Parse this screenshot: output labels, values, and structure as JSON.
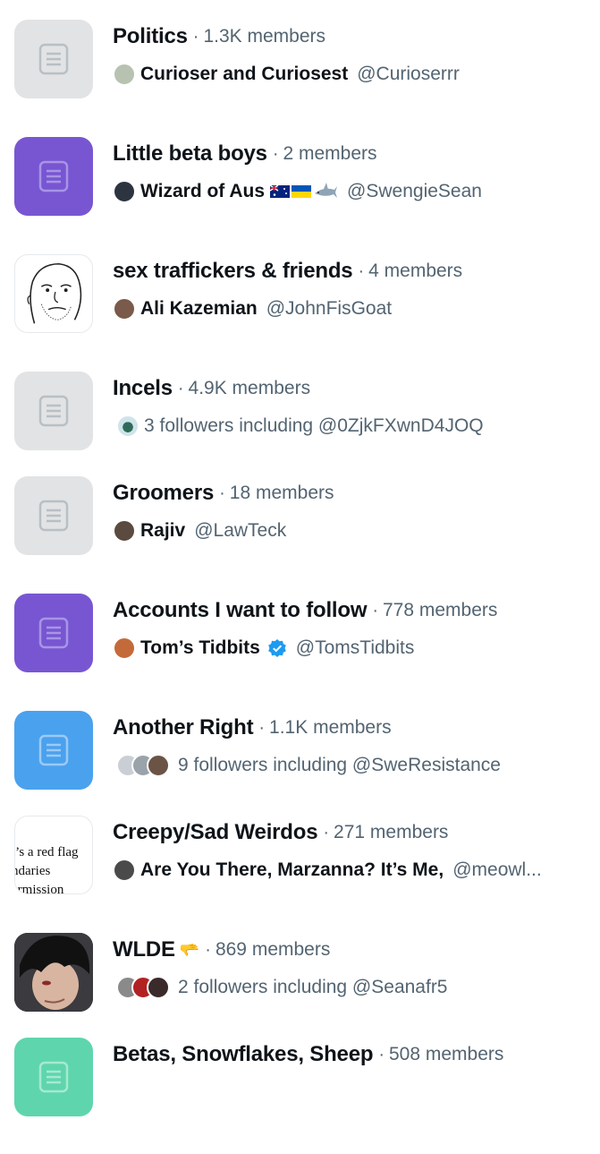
{
  "lists": [
    {
      "title": "Politics",
      "members": "1.3K members",
      "owner_name": "Curioser and Curiosest",
      "owner_handle": "@Curioserrr",
      "thumb": "gray-list-icon",
      "avatar_color": "#b7c2b0"
    },
    {
      "title": "Little beta boys",
      "members": "2 members",
      "owner_name": "Wizard of Aus",
      "owner_handle": "@SwengieSean",
      "thumb": "purple-list-icon",
      "avatar_color": "#2c3440",
      "badges": [
        "australia-flag-icon",
        "ukraine-flag-icon",
        "shark-icon"
      ]
    },
    {
      "title": "sex traffickers & friends",
      "members": "4 members",
      "owner_name": "Ali Kazemian",
      "owner_handle": "@JohnFisGoat",
      "thumb": "wojak-drawing-image",
      "avatar_color": "#7a5a4a"
    },
    {
      "title": "Incels",
      "members": "4.9K members",
      "followers_text": "3 followers including @0ZjkFXwnD4JOQ",
      "thumb": "gray-list-icon",
      "avatar_colors": [
        "#2f6a58"
      ]
    },
    {
      "title": "Groomers",
      "members": "18 members",
      "owner_name": "Rajiv",
      "owner_handle": "@LawTeck",
      "thumb": "gray-list-icon",
      "avatar_color": "#5b4a3f"
    },
    {
      "title": "Accounts I want to follow",
      "members": "778 members",
      "owner_name": "Tom’s Tidbits",
      "owner_handle": "@TomsTidbits",
      "thumb": "purple-list-icon",
      "avatar_color": "#c46a3a",
      "verified": true
    },
    {
      "title": "Another Right",
      "members": "1.1K members",
      "followers_text": "9 followers including @SweResistance",
      "thumb": "blue-list-icon",
      "avatar_colors": [
        "#c9cfd4",
        "#9aa3aa",
        "#6b5446"
      ]
    },
    {
      "title": "Creepy/Sad Weirdos",
      "members": "271 members",
      "owner_name": "Are You There, Marzanna? It’s Me,",
      "owner_handle": "@meowl...",
      "thumb": "text-image",
      "thumb_lines": [
        "t’s a red flag",
        "ndaries",
        "ermission"
      ],
      "avatar_color": "#4a4a4a"
    },
    {
      "title": "WLDE",
      "members": "869 members",
      "followers_text": "2 followers including @Seanafr5",
      "thumb": "emo-photo-image",
      "title_emoji": "🫳",
      "avatar_colors": [
        "#8a8a8a",
        "#b22222",
        "#3a2a2a"
      ]
    },
    {
      "title": "Betas, Snowflakes, Sheep",
      "members": "508 members",
      "thumb": "green-list-icon"
    }
  ],
  "colors": {
    "gray": "#e1e3e5",
    "purple": "#7856d2",
    "blue": "#4aa1ee",
    "green": "#5fd5ad",
    "secondary_text": "#536471",
    "verified": "#1d9bf0"
  }
}
